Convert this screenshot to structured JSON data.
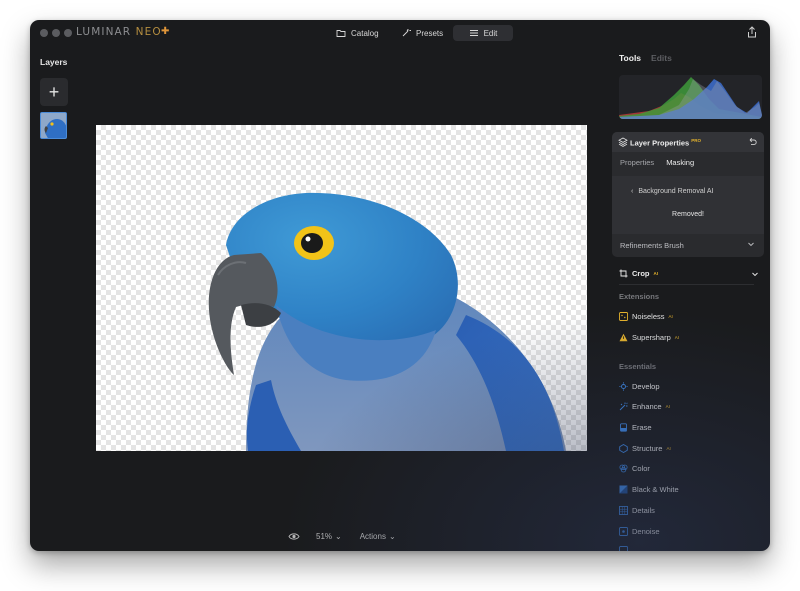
{
  "titlebar": {
    "logo_main": "LUMINAR",
    "logo_neo": "NEO",
    "nav": [
      {
        "label": "Catalog"
      },
      {
        "label": "Presets"
      },
      {
        "label": "Edit"
      }
    ]
  },
  "layers": {
    "title": "Layers"
  },
  "bottombar": {
    "zoom": "51%",
    "actions": "Actions"
  },
  "panel": {
    "tabs": [
      {
        "label": "Tools"
      },
      {
        "label": "Edits"
      }
    ],
    "layer_properties": {
      "title": "Layer Properties",
      "badge": "PRO",
      "subtabs": [
        {
          "label": "Properties"
        },
        {
          "label": "Masking"
        }
      ],
      "back_label": "Background Removal AI",
      "status": "Removed!",
      "refinements": "Refinements Brush"
    },
    "crop": {
      "label": "Crop",
      "badge": "AI"
    },
    "extensions": {
      "title": "Extensions",
      "items": [
        {
          "label": "Noiseless",
          "badge": "AI"
        },
        {
          "label": "Supersharp",
          "badge": "AI"
        }
      ]
    },
    "essentials": {
      "title": "Essentials",
      "items": [
        {
          "label": "Develop",
          "badge": ""
        },
        {
          "label": "Enhance",
          "badge": "AI"
        },
        {
          "label": "Erase",
          "badge": ""
        },
        {
          "label": "Structure",
          "badge": "AI"
        },
        {
          "label": "Color",
          "badge": ""
        },
        {
          "label": "Black & White",
          "badge": ""
        },
        {
          "label": "Details",
          "badge": ""
        },
        {
          "label": "Denoise",
          "badge": ""
        }
      ]
    }
  },
  "colors": {
    "accent_blue": "#3d86e0",
    "pro_gold": "#e4b22d",
    "window_bg": "#1a1b1d"
  }
}
